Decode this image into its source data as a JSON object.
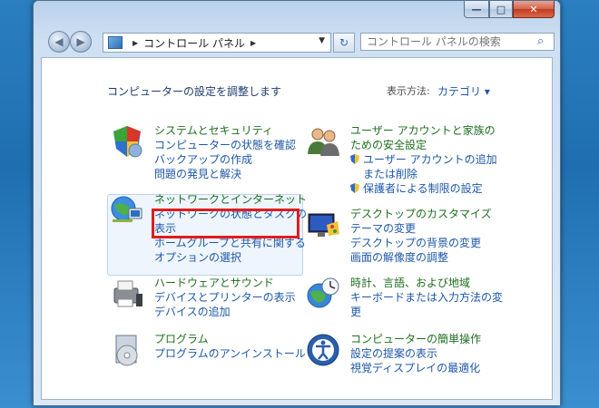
{
  "window": {
    "caption": {
      "minimize": "—",
      "maximize": "□",
      "close": "✕"
    }
  },
  "navbar": {
    "back_glyph": "◀",
    "forward_glyph": "▶",
    "address_path": "コントロール パネル",
    "refresh_glyph": "↻",
    "search_placeholder": "コントロール パネルの検索",
    "search_icon": "⌕"
  },
  "header": {
    "title": "コンピューターの設定を調整します",
    "view_by_label": "表示方法:",
    "view_by_value": "カテゴリ ▾"
  },
  "categories": {
    "system": {
      "title": "システムとセキュリティ",
      "links": [
        "コンピューターの状態を確認",
        "バックアップの作成",
        "問題の発見と解決"
      ]
    },
    "network": {
      "title": "ネットワークとインターネット",
      "links": [
        "ネットワークの状態とタスクの",
        "表示",
        "ホームグループと共有に関する",
        "オプションの選択"
      ]
    },
    "hardware": {
      "title": "ハードウェアとサウンド",
      "links": [
        "デバイスとプリンターの表示",
        "デバイスの追加"
      ]
    },
    "programs": {
      "title": "プログラム",
      "links": [
        "プログラムのアンインストール"
      ]
    },
    "users": {
      "title_line1": "ユーザー アカウントと家族の",
      "title_line2": "ための安全設定",
      "links": [
        "ユーザー アカウントの追加",
        "または削除",
        "保護者による制限の設定"
      ]
    },
    "appearance": {
      "title": "デスクトップのカスタマイズ",
      "links": [
        "テーマの変更",
        "デスクトップの背景の変更",
        "画面の解像度の調整"
      ]
    },
    "clock": {
      "title": "時計、言語、および地域",
      "links": [
        "キーボードまたは入力方法の変",
        "更"
      ]
    },
    "ease": {
      "title": "コンピューターの簡単操作",
      "links": [
        "設定の提案の表示",
        "視覚ディスプレイの最適化"
      ]
    }
  },
  "colors": {
    "category_title": "#1f6e1f",
    "link": "#1e57a8",
    "highlight": "#e21c1c"
  }
}
